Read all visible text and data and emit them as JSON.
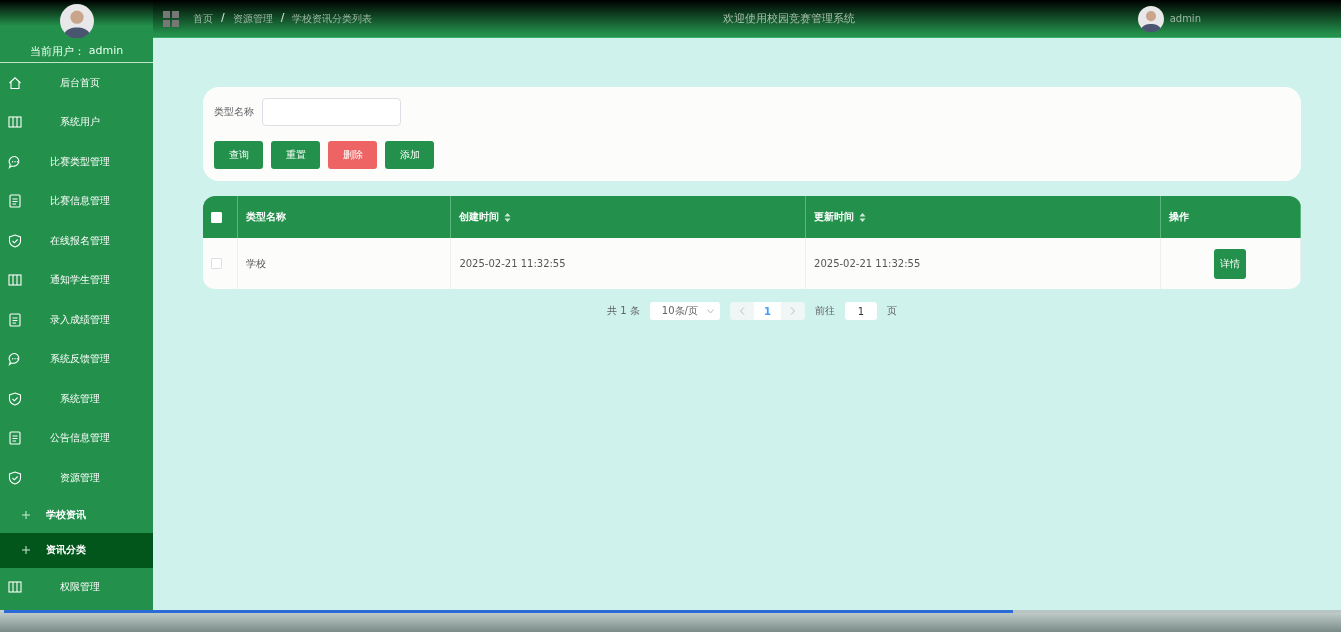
{
  "sidebar": {
    "current_user_label": "当前用户：",
    "current_user": "admin",
    "items": [
      {
        "label": "后台首页",
        "kind": "home",
        "selected": false
      },
      {
        "label": "系统用户",
        "kind": "columns",
        "selected": false
      },
      {
        "label": "比赛类型管理",
        "kind": "chat",
        "selected": false
      },
      {
        "label": "比赛信息管理",
        "kind": "doc",
        "selected": false
      },
      {
        "label": "在线报名管理",
        "kind": "shield",
        "selected": false
      },
      {
        "label": "通知学生管理",
        "kind": "columns",
        "selected": false
      },
      {
        "label": "录入成绩管理",
        "kind": "doc",
        "selected": false
      },
      {
        "label": "系统反馈管理",
        "kind": "chat",
        "selected": false
      },
      {
        "label": "系统管理",
        "kind": "shield",
        "selected": false
      },
      {
        "label": "公告信息管理",
        "kind": "doc",
        "selected": false
      },
      {
        "label": "资源管理",
        "kind": "shield",
        "selected": false,
        "children": [
          {
            "label": "学校资讯",
            "selected": false
          },
          {
            "label": "资讯分类",
            "selected": true
          }
        ]
      },
      {
        "label": "权限管理",
        "kind": "columns",
        "selected": false
      }
    ]
  },
  "header": {
    "breadcrumb": [
      {
        "kind": "link",
        "text": "首页"
      },
      {
        "kind": "separator",
        "text": "/"
      },
      {
        "kind": "link",
        "text": "资源管理"
      },
      {
        "kind": "separator",
        "text": "/"
      },
      {
        "kind": "link",
        "text": "学校资讯分类列表"
      }
    ],
    "title": "欢迎使用校园竞赛管理系统",
    "username": "admin"
  },
  "search": {
    "label": "类型名称"
  },
  "buttons": [
    {
      "label": "查询",
      "kind": "primary"
    },
    {
      "label": "重置",
      "kind": "primary"
    },
    {
      "label": "删除",
      "kind": "danger"
    },
    {
      "label": "添加",
      "kind": "primary"
    }
  ],
  "table": {
    "header_checked": false,
    "columns": [
      {
        "label": "类型名称",
        "sortable": false
      },
      {
        "label": "创建时间",
        "sortable": true
      },
      {
        "label": "更新时间",
        "sortable": true
      },
      {
        "label": "操作",
        "sortable": false
      }
    ],
    "rows": [
      {
        "checked": false,
        "cells": [
          "学校",
          "2025-02-21 11:32:55",
          "2025-02-21 11:32:55"
        ],
        "action": "详情"
      }
    ]
  },
  "pagination": {
    "total": "共 1 条",
    "page_size": "10条/页",
    "pages": [
      {
        "label": "1",
        "selected": true
      }
    ],
    "goto_label": "前往",
    "goto_value": "1",
    "goto_suffix": "页"
  },
  "player": {
    "level": 0.755
  }
}
